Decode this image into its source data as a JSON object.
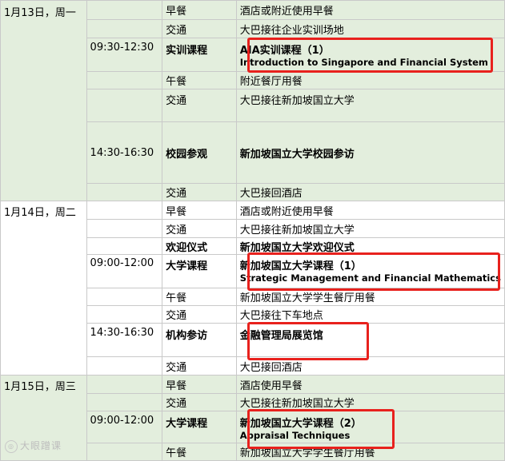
{
  "days": [
    {
      "date": "1月13日，周一",
      "rows": [
        {
          "time": "",
          "activity": "早餐",
          "detail": "酒店或附近使用早餐"
        },
        {
          "time": "",
          "activity": "交通",
          "detail": "大巴接往企业实训场地"
        },
        {
          "time": "09:30-12:30",
          "activity": "实训课程",
          "detail": "AIA实训课程（1）",
          "detail2": "Introduction to Singapore and Financial System"
        },
        {
          "time": "",
          "activity": "午餐",
          "detail": "附近餐厅用餐"
        },
        {
          "time": "",
          "activity": "交通",
          "detail": "大巴接往新加坡国立大学"
        },
        {
          "time": "14:30-16:30",
          "activity": "校园参观",
          "detail": "新加坡国立大学校园参访"
        },
        {
          "time": "",
          "activity": "交通",
          "detail": "大巴接回酒店"
        }
      ]
    },
    {
      "date": "1月14日，周二",
      "rows": [
        {
          "time": "",
          "activity": "早餐",
          "detail": "酒店或附近使用早餐"
        },
        {
          "time": "",
          "activity": "交通",
          "detail": "大巴接往新加坡国立大学"
        },
        {
          "time": "",
          "activity": "欢迎仪式",
          "detail": "新加坡国立大学欢迎仪式"
        },
        {
          "time": "09:00-12:00",
          "activity": "大学课程",
          "detail": "新加坡国立大学课程（1）",
          "detail2": "Strategic Management and Financial Mathematics"
        },
        {
          "time": "",
          "activity": "午餐",
          "detail": "新加坡国立大学学生餐厅用餐"
        },
        {
          "time": "",
          "activity": "交通",
          "detail": "大巴接往下车地点"
        },
        {
          "time": "14:30-16:30",
          "activity": "机构参访",
          "detail": "金融管理局展览馆"
        },
        {
          "time": "",
          "activity": "交通",
          "detail": "大巴接回酒店"
        }
      ]
    },
    {
      "date": "1月15日，周三",
      "rows": [
        {
          "time": "",
          "activity": "早餐",
          "detail": "酒店使用早餐"
        },
        {
          "time": "",
          "activity": "交通",
          "detail": "大巴接往新加坡国立大学"
        },
        {
          "time": "09:00-12:00",
          "activity": "大学课程",
          "detail": "新加坡国立大学课程（2）",
          "detail2": "Appraisal Techniques"
        },
        {
          "time": "",
          "activity": "午餐",
          "detail": "新加坡国立大学学生餐厅用餐"
        }
      ]
    }
  ],
  "watermark": "大眼蹭课",
  "colors": {
    "day_shade": "#e3eedd",
    "highlight": "#e8211d",
    "grid": "#c9c9c9"
  }
}
